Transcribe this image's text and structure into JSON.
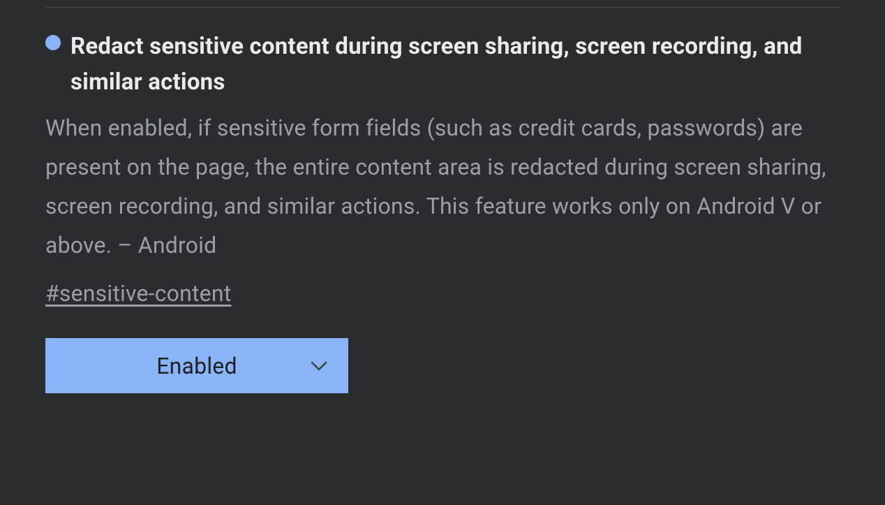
{
  "flag": {
    "title": "Redact sensitive content during screen sharing, screen recording, and similar actions",
    "description": "When enabled, if sensitive form fields (such as credit cards, passwords) are present on the page, the entire content area is redacted during screen sharing, screen recording, and similar actions. This feature works only on Android V or above. – Android",
    "hash": "#sensitive-content",
    "dropdown_value": "Enabled"
  },
  "colors": {
    "accent": "#8ab4f8",
    "background": "#2b2c2f",
    "title_text": "#e8eaed",
    "body_text": "#9aa0a6",
    "dropdown_text": "#202124"
  }
}
